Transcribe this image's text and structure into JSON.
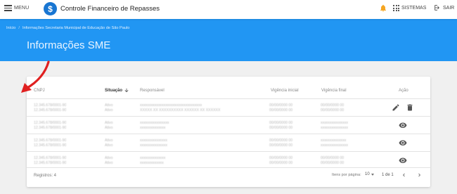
{
  "topbar": {
    "menu_label": "MENU",
    "app_title": "Controle Financeiro de Repasses",
    "logo_glyph": "$",
    "bell_icon": "bell-icon",
    "bell_color": "#f5a623",
    "sistemas_label": "SISTEMAS",
    "sair_label": "SAIR"
  },
  "header": {
    "breadcrumb": [
      "Início",
      "Informações Secretaria Municipal de Educação de São Paulo"
    ],
    "breadcrumb_sep": "/",
    "title": "Informações SME",
    "color": "#2196f3"
  },
  "table": {
    "columns": [
      "CNPJ",
      "Situação",
      "Responsável",
      "Vigência inicial",
      "Vigência final",
      "Ação"
    ],
    "sorted_column": "Situação",
    "rows": [
      {
        "cnpj": [
          "12.345.678/0001-90",
          "12.345.678/0001-90"
        ],
        "situacao": [
          "Ativo",
          "Ativo"
        ],
        "responsavel": [
          "xxxxxxxxxxxxxxxxxxxxxxxxxxxxxxxxxx",
          "XXXXX XX XXXXXXXXXX XXXXXX XX XXXXXX"
        ],
        "vig_ini": [
          "00/00/0000 00",
          "00/00/0000 00"
        ],
        "vig_fim": [
          "00/00/0000 00",
          "00/00/0000 00"
        ],
        "actions": [
          "edit-icon",
          "delete-icon"
        ]
      },
      {
        "cnpj": [
          "12.345.678/0001-90",
          "12.345.678/0001-90"
        ],
        "situacao": [
          "Ativo",
          "Ativo"
        ],
        "responsavel": [
          "xxxxxxxxxxxxxxxx",
          "xxxxxxxxxxxxxx"
        ],
        "vig_ini": [
          "00/00/0000 00",
          "00/00/0000 00"
        ],
        "vig_fim": [
          "xxxxxxxxxxxxxxx",
          "xxxxxxxxxxxxxxx"
        ],
        "actions": [
          "view-icon"
        ]
      },
      {
        "cnpj": [
          "12.345.678/0001-90",
          "12.345.678/0001-90"
        ],
        "situacao": [
          "Ativo",
          "Ativo"
        ],
        "responsavel": [
          "xxxxxxxxxxxxxxx",
          "xxxxxxxxxxxxxxx"
        ],
        "vig_ini": [
          "00/00/0000 00",
          "00/00/0000 00"
        ],
        "vig_fim": [
          "xxxxxxxxxxxxxx",
          "xxxxxxxxxxxxxxx"
        ],
        "actions": [
          "view-icon"
        ]
      },
      {
        "cnpj": [
          "12.345.678/0001-90",
          "12.345.678/0001-90"
        ],
        "situacao": [
          "Ativo",
          "Ativo"
        ],
        "responsavel": [
          "xxxxxxxxxxxxxx",
          "xxxxxxxxxxxxx"
        ],
        "vig_ini": [
          "00/00/0000 00",
          "00/00/0000 00"
        ],
        "vig_fim": [
          "00/00/0000 00",
          "00/00/0000 00"
        ],
        "actions": [
          "view-icon"
        ]
      }
    ]
  },
  "footer": {
    "registros": "Registros: 4",
    "items_per_page_label": "Itens por página:",
    "items_per_page": "10",
    "range": "1 de 1"
  },
  "annotation": {
    "color": "#e02020"
  }
}
